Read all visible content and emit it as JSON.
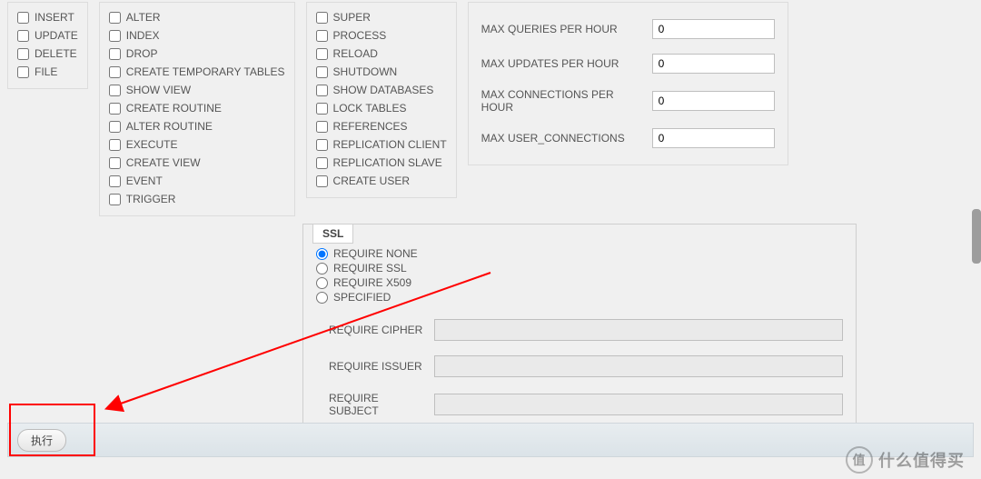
{
  "privs_col1": [
    "INSERT",
    "UPDATE",
    "DELETE",
    "FILE"
  ],
  "privs_col2": [
    "ALTER",
    "INDEX",
    "DROP",
    "CREATE TEMPORARY TABLES",
    "SHOW VIEW",
    "CREATE ROUTINE",
    "ALTER ROUTINE",
    "EXECUTE",
    "CREATE VIEW",
    "EVENT",
    "TRIGGER"
  ],
  "privs_col3": [
    "SUPER",
    "PROCESS",
    "RELOAD",
    "SHUTDOWN",
    "SHOW DATABASES",
    "LOCK TABLES",
    "REFERENCES",
    "REPLICATION CLIENT",
    "REPLICATION SLAVE",
    "CREATE USER"
  ],
  "limits": {
    "queries": {
      "label": "MAX QUERIES PER HOUR",
      "value": "0"
    },
    "updates": {
      "label": "MAX UPDATES PER HOUR",
      "value": "0"
    },
    "conns": {
      "label": "MAX CONNECTIONS PER HOUR",
      "value": "0"
    },
    "userconn": {
      "label": "MAX USER_CONNECTIONS",
      "value": "0"
    }
  },
  "ssl": {
    "legend": "SSL",
    "options": {
      "none": "REQUIRE NONE",
      "ssl": "REQUIRE SSL",
      "x509": "REQUIRE X509",
      "spec": "SPECIFIED"
    },
    "cipher_label": "REQUIRE CIPHER",
    "issuer_label": "REQUIRE ISSUER",
    "subject_label": "REQUIRE SUBJECT",
    "cipher_value": "",
    "issuer_value": "",
    "subject_value": ""
  },
  "footer": {
    "execute_label": "执行"
  },
  "watermark": {
    "char": "值",
    "text": "什么值得买"
  }
}
